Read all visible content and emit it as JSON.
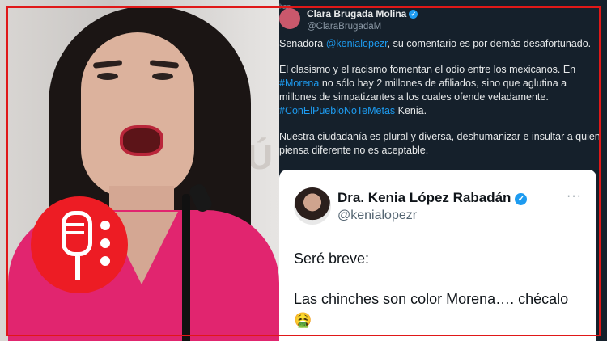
{
  "colors": {
    "frame": "#e01818",
    "logo": "#ed1c24",
    "tweet_bg": "#15202b",
    "link": "#1d9bf0",
    "jacket": "#e1256f"
  },
  "photo": {
    "wall_text": "PÚ"
  },
  "tweet": {
    "top_label": "ltas",
    "author_name": "Clara Brugada Molina",
    "author_handle": "@ClaraBrugadaM",
    "verified_icon": "✓",
    "p1_prefix": "Senadora ",
    "p1_mention": "@kenialopezr",
    "p1_suffix": ", su comentario es por demás desafortunado.",
    "p2_a": "El clasismo y el racismo fomentan el odio entre los mexicanos. En ",
    "p2_hashtag1": "#Morena",
    "p2_b": " no sólo hay 2 millones de afiliados, sino que aglutina a millones de simpatizantes a los cuales ofende veladamente. ",
    "p2_hashtag2": "#ConElPuebloNoTeMetas",
    "p2_c": " Kenia.",
    "p3": "Nuestra ciudadanía es plural y diversa, deshumanizar e insultar a quien piensa diferente no es aceptable."
  },
  "quoted": {
    "author_name": "Dra. Kenia López Rabadán",
    "author_handle": "@kenialopezr",
    "verified_icon": "✓",
    "more_icon": "···",
    "line1": "Seré breve:",
    "line2": "Las chinches son color Morena…. chécalo",
    "emoji": "🤮"
  }
}
